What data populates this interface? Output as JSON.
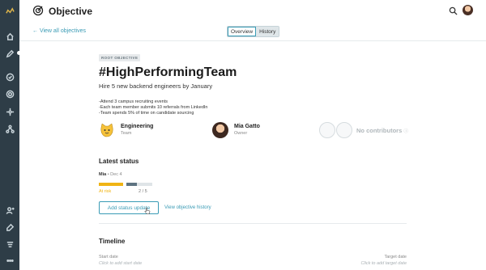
{
  "header": {
    "title": "Objective"
  },
  "nav": {
    "back_label": "← View all objectives",
    "tabs": [
      {
        "label": "Overview",
        "active": true
      },
      {
        "label": "History",
        "active": false
      }
    ]
  },
  "objective": {
    "badge": "ROOT OBJECTIVE",
    "title": "#HighPerformingTeam",
    "subtitle": "Hire 5 new backend engineers by January",
    "description": [
      "-Attend 3 campus recruiting events",
      "-Each team member submits 10 referrals from LinkedIn",
      "-Team spends 5% of time on candidate sourcing"
    ]
  },
  "people": {
    "team": {
      "name": "Engineering",
      "role": "Team"
    },
    "owner": {
      "name": "Mia Gatto",
      "role": "Owner"
    },
    "contributors_label": "No contributors"
  },
  "latest_status": {
    "heading": "Latest status",
    "author": "Mia",
    "date": "• Dec 4",
    "status_label": "At risk",
    "status_color": "#f0b414",
    "progress_label": "2 / 5",
    "progress_fraction": 0.4,
    "add_button": "Add status update",
    "history_link": "View objective history"
  },
  "timeline": {
    "heading": "Timeline",
    "start_label": "Start date",
    "start_placeholder": "Click to add start date",
    "target_label": "Target date",
    "target_placeholder": "Click to add target date"
  },
  "colors": {
    "accent": "#3a9bb5",
    "sidebar": "#2e3d47",
    "at_risk": "#f0b414"
  }
}
